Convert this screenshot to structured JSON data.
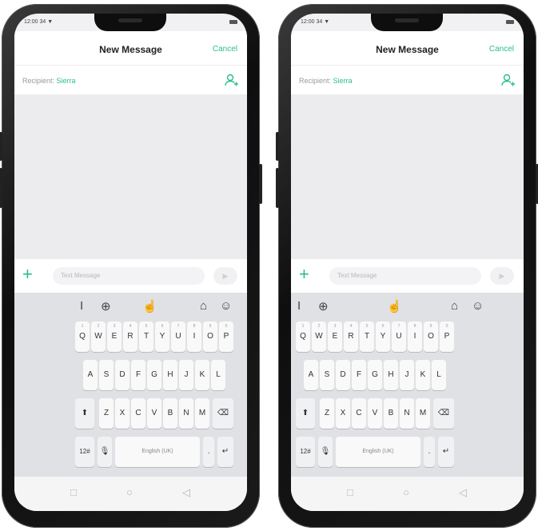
{
  "screens": [
    {
      "status_time": "12:00 34 ▼",
      "title": "New Message",
      "cancel": "Cancel",
      "recipient_label": "Recipient:",
      "recipient_name": "Sierra",
      "message_placeholder": "Text Message",
      "send_icon": "send-icon"
    },
    {
      "status_time": "12:00 34 ▼",
      "title": "New Message",
      "cancel": "Cancel",
      "recipient_label": "Recipient:",
      "recipient_name": "Sierra",
      "message_placeholder": "Text Message",
      "send_icon": "send-icon"
    }
  ],
  "keyboard": {
    "row1": [
      "Q",
      "W",
      "E",
      "R",
      "T",
      "Y",
      "U",
      "I",
      "O",
      "P"
    ],
    "row1_hints": [
      "1",
      "2",
      "3",
      "4",
      "5",
      "6",
      "7",
      "8",
      "9",
      "0"
    ],
    "row2": [
      "A",
      "S",
      "D",
      "F",
      "G",
      "H",
      "J",
      "K",
      "L"
    ],
    "row3": [
      "Z",
      "X",
      "C",
      "V",
      "B",
      "N",
      "M"
    ],
    "numbers_key": "12#",
    "space_label": "English (UK)",
    "period": ".",
    "enter": "↵",
    "shift": "⬆",
    "backspace": "⌫"
  },
  "colors": {
    "accent": "#2bbd8c",
    "keyboard_bg": "#dfe1e4"
  }
}
